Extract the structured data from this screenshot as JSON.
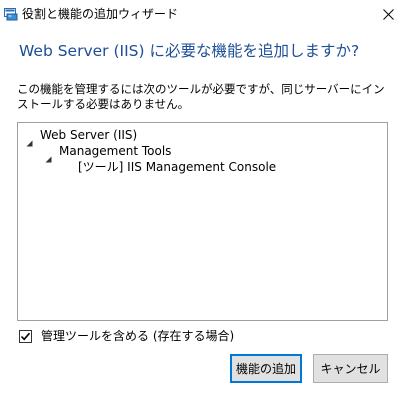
{
  "window": {
    "title": "役割と機能の追加ウィザード",
    "close_glyph": "✕"
  },
  "heading": "Web Server (IIS) に必要な機能を追加しますか?",
  "description": "この機能を管理するには次のツールが必要ですが、同じサーバーにインストールする必要はありません。",
  "tree": {
    "root": "Web Server (IIS)",
    "child": "Management Tools",
    "leaf": "[ツール] IIS Management Console"
  },
  "include_tools": {
    "label": "管理ツールを含める (存在する場合)",
    "checked": true
  },
  "buttons": {
    "add_features": "機能の追加",
    "cancel": "キャンセル"
  },
  "colors": {
    "heading": "#1e4e96",
    "primary_border": "#0078d7",
    "button_bg": "#e1e1e1"
  }
}
